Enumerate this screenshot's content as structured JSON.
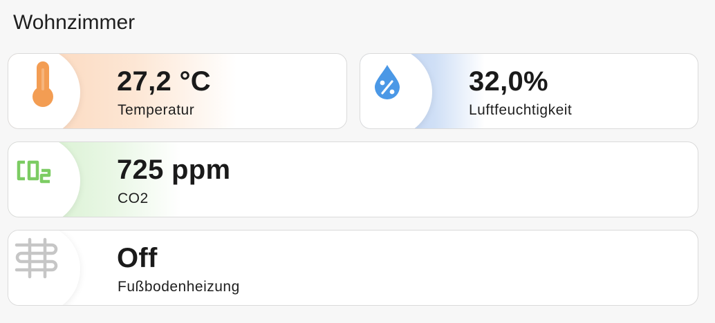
{
  "room": {
    "title": "Wohnzimmer"
  },
  "tiles": [
    {
      "value": "27,2 °C",
      "label": "Temperatur",
      "icon": "thermometer-icon",
      "color": "#f5a15d"
    },
    {
      "value": "32,0%",
      "label": "Luftfeuchtigkeit",
      "icon": "water-percent-icon",
      "color": "#4a90e2"
    },
    {
      "value": "725 ppm",
      "label": "CO2",
      "icon": "molecule-co2-icon",
      "color": "#8fd37a"
    },
    {
      "value": "Off",
      "label": "Fußbodenheizung",
      "icon": "heating-coil-icon",
      "color": "#c8c8c8"
    }
  ]
}
